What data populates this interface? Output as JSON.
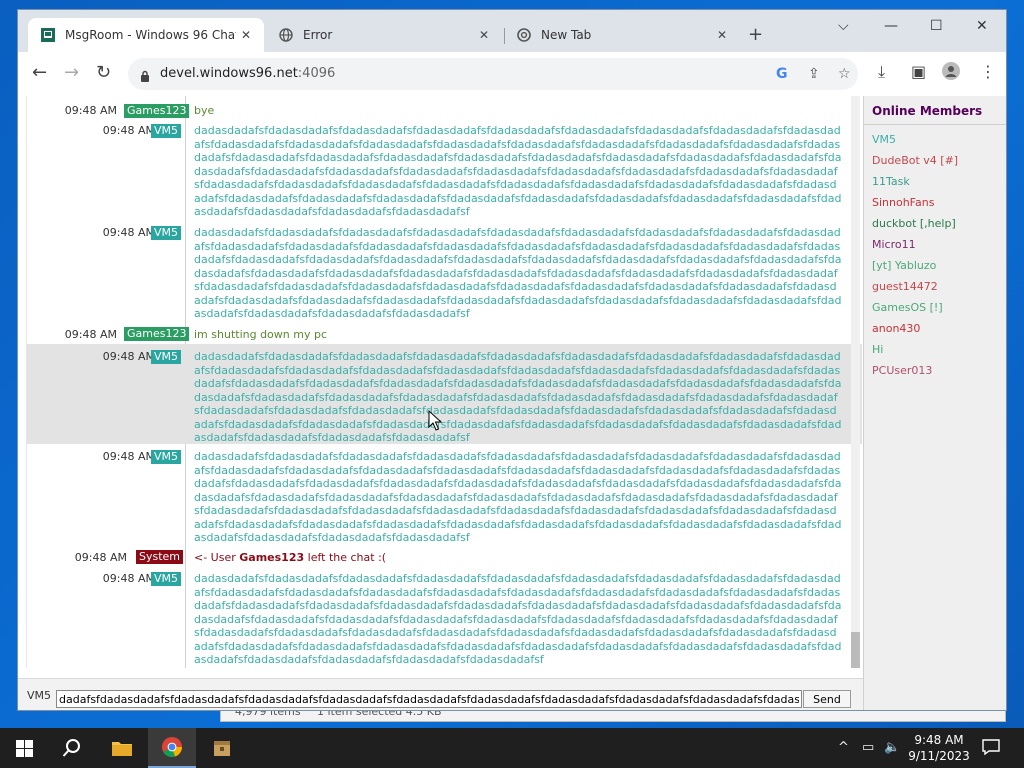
{
  "browser": {
    "tabs": [
      {
        "title": "MsgRoom - Windows 96 Chat",
        "active": true
      },
      {
        "title": "Error",
        "active": false
      },
      {
        "title": "New Tab",
        "active": false
      }
    ],
    "url_host": "devel.windows96.net",
    "url_port": ":4096"
  },
  "chat": {
    "messages": [
      {
        "time": "09:48 AM",
        "user": "Games123",
        "user_color": "#2a9d63",
        "text": "bye",
        "text_color": "#5a8a30"
      },
      {
        "time": "09:48 AM",
        "user": "VM5",
        "user_color": "#2aa6a0",
        "text": "dadasdadafsfdadasdadafsfdadasdadafsfdadasdadafsfdadasdadafsfdadasdadafsfdadasdadafsfdadasdadafsfdadasdadafsfdadasdadafsfdadasdadafsfdadasdadafsfdadasdadafsfdadasdadafsfdadasdadafsfdadasdadafsfdadasdadafsfdadasdadafsfdadasdadafsfdadasdadafsfdadasdadafsfdadasdadafsfdadasdadafsfdadasdadafsfdadasdadafsfdadasdadafsfdadasdadafsfdadasdadafsfdadasdadafsfdadasdadafsfdadasdadafsfdadasdadafsfdadasdadafsfdadasdadafsfdadasdadafsfdadasdadafsfdadasdadafsfdadasdadafsfdadasdadafsfdadasdadafsfdadasdadafsfdadasdadafsfdadasdadafsfdadasdadafsfdadasdadafsfdadasdadafsfdadasdadafsfdadasdadafsfdadasdadafsfdadasdadafsfdadasdadafsfdadasdadafsfdadasdadafsfdadasdadafsfdadasdadafsfdadasdadafsf",
        "text_color": "#3bb0a8"
      },
      {
        "time": "09:48 AM",
        "user": "VM5",
        "user_color": "#2aa6a0",
        "text": "dadasdadafsfdadasdadafsfdadasdadafsfdadasdadafsfdadasdadafsfdadasdadafsfdadasdadafsfdadasdadafsfdadasdadafsfdadasdadafsfdadasdadafsfdadasdadafsfdadasdadafsfdadasdadafsfdadasdadafsfdadasdadafsfdadasdadafsfdadasdadafsfdadasdadafsfdadasdadafsfdadasdadafsfdadasdadafsfdadasdadafsfdadasdadafsfdadasdadafsfdadasdadafsfdadasdadafsfdadasdadafsfdadasdadafsfdadasdadafsfdadasdadafsfdadasdadafsfdadasdadafsfdadasdadafsfdadasdadafsfdadasdadafsfdadasdadafsfdadasdadafsfdadasdadafsfdadasdadafsfdadasdadafsfdadasdadafsfdadasdadafsfdadasdadafsfdadasdadafsfdadasdadafsfdadasdadafsfdadasdadafsfdadasdadafsfdadasdadafsfdadasdadafsfdadasdadafsfdadasdadafsfdadasdadafsfdadasdadafsfdadasdadafsf",
        "text_color": "#3bb0a8"
      },
      {
        "time": "09:48 AM",
        "user": "Games123",
        "user_color": "#2a9d63",
        "text": "im shutting down my pc",
        "text_color": "#5a8a30"
      },
      {
        "time": "09:48 AM",
        "user": "VM5",
        "user_color": "#2aa6a0",
        "text": "dadasdadafsfdadasdadafsfdadasdadafsfdadasdadafsfdadasdadafsfdadasdadafsfdadasdadafsfdadasdadafsfdadasdadafsfdadasdadafsfdadasdadafsfdadasdadafsfdadasdadafsfdadasdadafsfdadasdadafsfdadasdadafsfdadasdadafsfdadasdadafsfdadasdadafsfdadasdadafsfdadasdadafsfdadasdadafsfdadasdadafsfdadasdadafsfdadasdadafsfdadasdadafsfdadasdadafsfdadasdadafsfdadasdadafsfdadasdadafsfdadasdadafsfdadasdadafsfdadasdadafsfdadasdadafsfdadasdadafsfdadasdadafsfdadasdadafsfdadasdadafsfdadasdadafsfdadasdadafsfdadasdadafsfdadasdadafsfdadasdadafsfdadasdadafsfdadasdadafsfdadasdadafsfdadasdadafsfdadasdadafsfdadasdadafsfdadasdadafsfdadasdadafsfdadasdadafsfdadasdadafsfdadasdadafsfdadasdadafsfdadasdadafsf",
        "text_color": "#3bb0a8"
      },
      {
        "time": "09:48 AM",
        "user": "VM5",
        "user_color": "#2aa6a0",
        "text": "dadasdadafsfdadasdadafsfdadasdadafsfdadasdadafsfdadasdadafsfdadasdadafsfdadasdadafsfdadasdadafsfdadasdadafsfdadasdadafsfdadasdadafsfdadasdadafsfdadasdadafsfdadasdadafsfdadasdadafsfdadasdadafsfdadasdadafsfdadasdadafsfdadasdadafsfdadasdadafsfdadasdadafsfdadasdadafsfdadasdadafsfdadasdadafsfdadasdadafsfdadasdadafsfdadasdadafsfdadasdadafsfdadasdadafsfdadasdadafsfdadasdadafsfdadasdadafsfdadasdadafsfdadasdadafsfdadasdadafsfdadasdadafsfdadasdadafsfdadasdadafsfdadasdadafsfdadasdadafsfdadasdadafsfdadasdadafsfdadasdadafsfdadasdadafsfdadasdadafsfdadasdadafsfdadasdadafsfdadasdadafsfdadasdadafsfdadasdadafsfdadasdadafsfdadasdadafsfdadasdadafsfdadasdadafsfdadasdadafsfdadasdadafsf",
        "text_color": "#3bb0a8"
      },
      {
        "time": "09:48 AM",
        "user": "System",
        "user_color": "#8b0a16",
        "system": true,
        "text_prefix": "<- User ",
        "text_user": "Games123",
        "text_suffix": " left the chat :(",
        "text_color": "#8b0a16"
      },
      {
        "time": "09:48 AM",
        "user": "VM5",
        "user_color": "#2aa6a0",
        "text": "dadasdadafsfdadasdadafsfdadasdadafsfdadasdadafsfdadasdadafsfdadasdadafsfdadasdadafsfdadasdadafsfdadasdadafsfdadasdadafsfdadasdadafsfdadasdadafsfdadasdadafsfdadasdadafsfdadasdadafsfdadasdadafsfdadasdadafsfdadasdadafsfdadasdadafsfdadasdadafsfdadasdadafsfdadasdadafsfdadasdadafsfdadasdadafsfdadasdadafsfdadasdadafsfdadasdadafsfdadasdadafsfdadasdadafsfdadasdadafsfdadasdadafsfdadasdadafsfdadasdadafsfdadasdadafsfdadasdadafsfdadasdadafsfdadasdadafsfdadasdadafsfdadasdadafsfdadasdadafsfdadasdadafsfdadasdadafsfdadasdadafsfdadasdadafsfdadasdadafsfdadasdadafsfdadasdadafsfdadasdadafsfdadasdadafsfdadasdadafsfdadasdadafsfdadasdadafsfdadasdadafsfdadasdadafsfdadasdadafsfdadasdadafsfdadasdadafsf",
        "text_color": "#3bb0a8"
      }
    ],
    "composer": {
      "nick": "VM5",
      "value": "dadafsfdadasdadafsfdadasdadafsfdadasdadafsfdadasdadafsfdadasdadafsfdadasdadafsfdadasdadafsfdadasdadafsfdadasdadafsfdadasdadafsf",
      "send_label": "Send"
    }
  },
  "members": {
    "heading": "Online Members",
    "list": [
      {
        "name": "VM5",
        "color": "#3bb0a8"
      },
      {
        "name": "DudeBot v4 [#]",
        "color": "#c2484f"
      },
      {
        "name": "11Task",
        "color": "#3a9d8f"
      },
      {
        "name": "SinnohFans",
        "color": "#c8323a"
      },
      {
        "name": "duckbot [,help]",
        "color": "#2a7a4a"
      },
      {
        "name": "Micro11",
        "color": "#7a2a6a"
      },
      {
        "name": "[yt] Yabluzo",
        "color": "#4aa87a"
      },
      {
        "name": "guest14472",
        "color": "#c2484f"
      },
      {
        "name": "GamesOS [!]",
        "color": "#4aa87a"
      },
      {
        "name": "anon430",
        "color": "#c8323a"
      },
      {
        "name": "Hi",
        "color": "#4aa87a"
      },
      {
        "name": "PCUser013",
        "color": "#b0506a"
      }
    ]
  },
  "explorer_behind": {
    "items_count": "4,979 items",
    "selected": "1 item selected  4.5 KB"
  },
  "taskbar": {
    "time": "9:48 AM",
    "date": "9/11/2023"
  }
}
